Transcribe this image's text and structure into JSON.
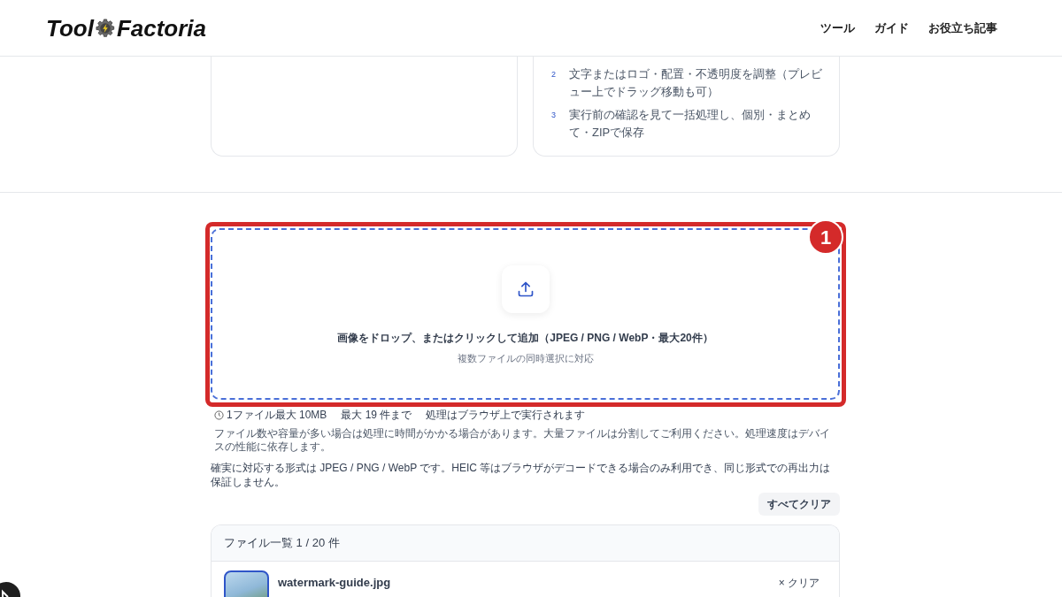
{
  "header": {
    "logo": {
      "part_1": "Tool",
      "part_2": "Factoria"
    },
    "nav": [
      {
        "label": "ツール"
      },
      {
        "label": "ガイド"
      },
      {
        "label": "お役立ち記事"
      }
    ]
  },
  "steps_card": {
    "steps": [
      {
        "number": "2",
        "text": "文字またはロゴ・配置・不透明度を調整（プレビュー上でドラッグ移動も可）"
      },
      {
        "number": "3",
        "text": "実行前の確認を見て一括処理し、個別・まとめて・ZIPで保存"
      }
    ]
  },
  "dropzone": {
    "title": "画像をドロップ、またはクリックして追加（JPEG / PNG / WebP・最大20件）",
    "subtitle": "複数ファイルの同時選択に対応"
  },
  "annotation": {
    "badge": "1"
  },
  "limits": [
    "1ファイル最大 10MB",
    "最大 19 件まで",
    "処理はブラウザ上で実行されます"
  ],
  "notes": [
    "ファイル数や容量が多い場合は処理に時間がかかる場合があります。大量ファイルは分割してご利用ください。処理速度はデバイスの性能に依存します。",
    "確実に対応する形式は JPEG / PNG / WebP です。HEIC 等はブラウザがデコードできる場合のみ利用でき、同じ形式での再出力は保証しません。"
  ],
  "clear_all_button": "すべてクリア",
  "file_list": {
    "title": "ファイル一覧 1 / 20 件",
    "files": [
      {
        "name": "watermark-guide.jpg",
        "selected": true,
        "remove_label": "× クリア"
      }
    ]
  }
}
